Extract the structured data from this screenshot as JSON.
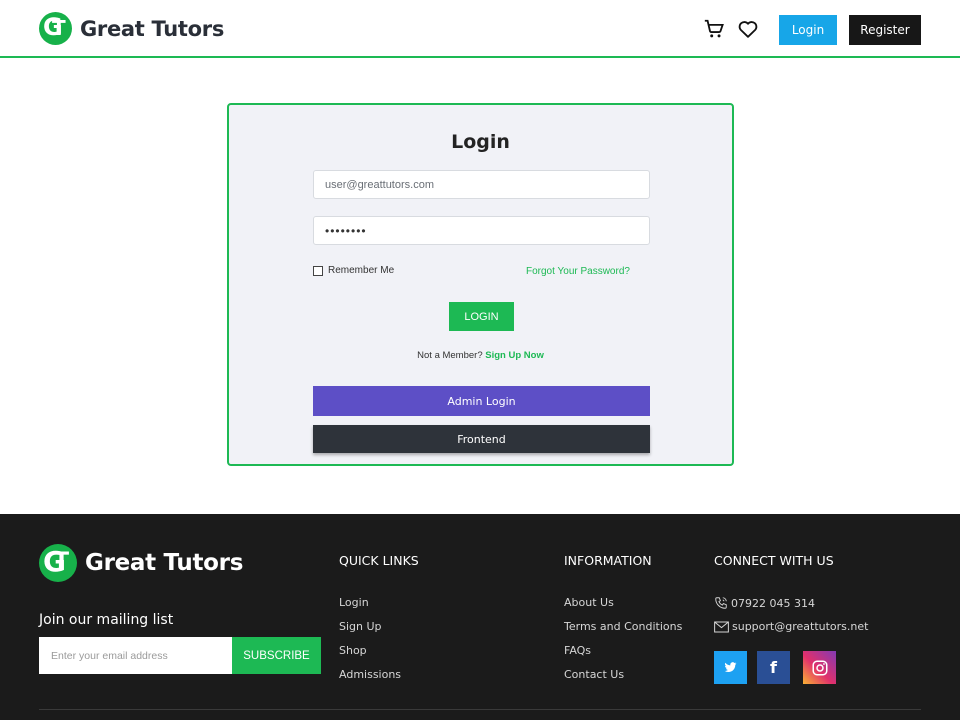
{
  "header": {
    "brand": "Great Tutors",
    "login_label": "Login",
    "register_label": "Register",
    "icons": [
      "cart-icon",
      "heart-icon"
    ]
  },
  "login_card": {
    "title": "Login",
    "email_value": "user@greattutors.com",
    "password_value": "••••••••",
    "remember_label": "Remember Me",
    "forgot_label": "Forgot Your Password?",
    "submit_label": "LOGIN",
    "not_member_text": "Not a Member?",
    "signup_label": "Sign Up Now",
    "admin_label": "Admin Login",
    "frontend_label": "Frontend"
  },
  "footer": {
    "brand": "Great Tutors",
    "mailing_title": "Join our mailing list",
    "email_placeholder": "Enter your email address",
    "subscribe_label": "SUBSCRIBE",
    "quick_links": {
      "title": "QUICK LINKS",
      "items": [
        "Login",
        "Sign Up",
        "Shop",
        "Admissions"
      ]
    },
    "information": {
      "title": "INFORMATION",
      "items": [
        "About Us",
        "Terms and Conditions",
        "FAQs",
        "Contact Us"
      ]
    },
    "connect": {
      "title": "CONNECT WITH US",
      "phone": "07922 045 314",
      "email": "support@greattutors.net"
    }
  },
  "colors": {
    "accent_green": "#1db954",
    "login_blue": "#17a6e8",
    "admin_purple": "#5d4fc6",
    "frontend_dark": "#2e333a",
    "footer_bg": "#1b1b1b"
  }
}
